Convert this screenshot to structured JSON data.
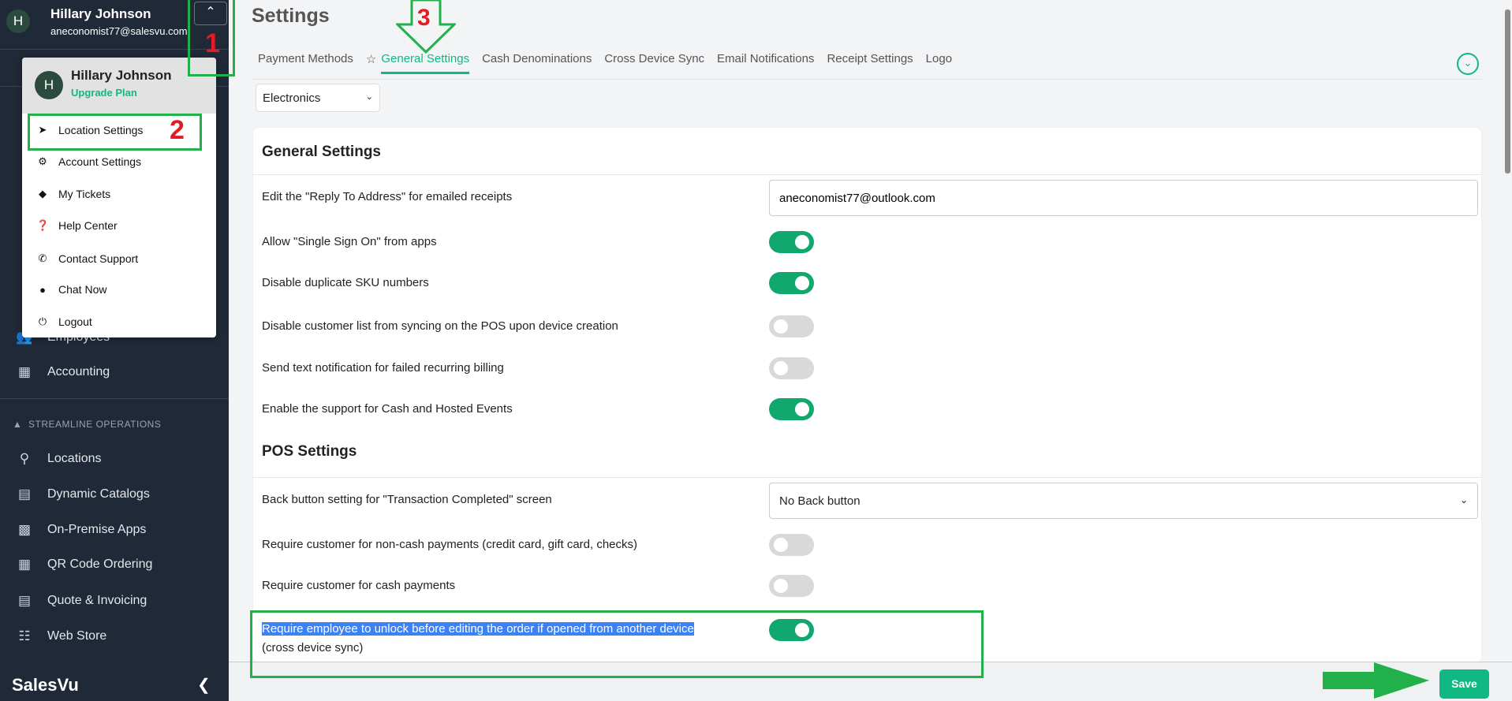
{
  "user": {
    "initial": "H",
    "name": "Hillary Johnson",
    "email": "aneconomist77@salesvu.com"
  },
  "sidebar": {
    "items": [
      {
        "label": "Employees",
        "icon": "employees-icon"
      },
      {
        "label": "Accounting",
        "icon": "calculator-icon"
      }
    ],
    "section": "STREAMLINE OPERATIONS",
    "section_items": [
      {
        "label": "Locations",
        "icon": "location-pin-icon"
      },
      {
        "label": "Dynamic Catalogs",
        "icon": "catalog-icon"
      },
      {
        "label": "On-Premise Apps",
        "icon": "pos-terminal-icon"
      },
      {
        "label": "QR Code Ordering",
        "icon": "qr-code-icon"
      },
      {
        "label": "Quote & Invoicing",
        "icon": "invoice-icon"
      },
      {
        "label": "Web Store",
        "icon": "web-store-icon"
      }
    ],
    "brand": "SalesVu"
  },
  "menu": {
    "name": "Hillary Johnson",
    "upgrade": "Upgrade Plan",
    "items": [
      {
        "label": "Location Settings",
        "icon": "navigation-arrow-icon"
      },
      {
        "label": "Account Settings",
        "icon": "gear-icon"
      },
      {
        "label": "My Tickets",
        "icon": "ticket-icon"
      },
      {
        "label": "Help Center",
        "icon": "question-circle-icon"
      },
      {
        "label": "Contact Support",
        "icon": "phone-icon"
      },
      {
        "label": "Chat Now",
        "icon": "chat-bubble-icon"
      },
      {
        "label": "Logout",
        "icon": "power-icon"
      }
    ]
  },
  "page": {
    "title": "Settings",
    "tabs": [
      "Payment Methods",
      "General Settings",
      "Cash Denominations",
      "Cross Device Sync",
      "Email Notifications",
      "Receipt Settings",
      "Logo"
    ],
    "active_tab": "General Settings",
    "location": "Electronics"
  },
  "general": {
    "title": "General Settings",
    "reply_label": "Edit the \"Reply To Address\" for emailed receipts",
    "reply_value": "aneconomist77@outlook.com",
    "toggles": [
      {
        "label": "Allow \"Single Sign On\" from apps",
        "on": true
      },
      {
        "label": "Disable duplicate SKU numbers",
        "on": true
      },
      {
        "label": "Disable customer list from syncing on the POS upon device creation",
        "on": false
      },
      {
        "label": "Send text notification for failed recurring billing",
        "on": false
      },
      {
        "label": "Enable the support for Cash and Hosted Events",
        "on": true
      }
    ]
  },
  "pos": {
    "title": "POS Settings",
    "back_label": "Back button setting for \"Transaction Completed\" screen",
    "back_value": "No Back button",
    "toggles": [
      {
        "label": "Require customer for non-cash payments (credit card, gift card, checks)",
        "on": false
      },
      {
        "label": "Require customer for cash payments",
        "on": false
      }
    ],
    "unlock_label_selected": "Require employee to unlock before editing the order if opened from another device",
    "unlock_label_rest": "(cross device sync)",
    "unlock_on": true
  },
  "save": "Save",
  "annotations": {
    "n1": "1",
    "n2": "2",
    "n3": "3",
    "color": "#22b04b",
    "num_color": "#e31b23"
  }
}
